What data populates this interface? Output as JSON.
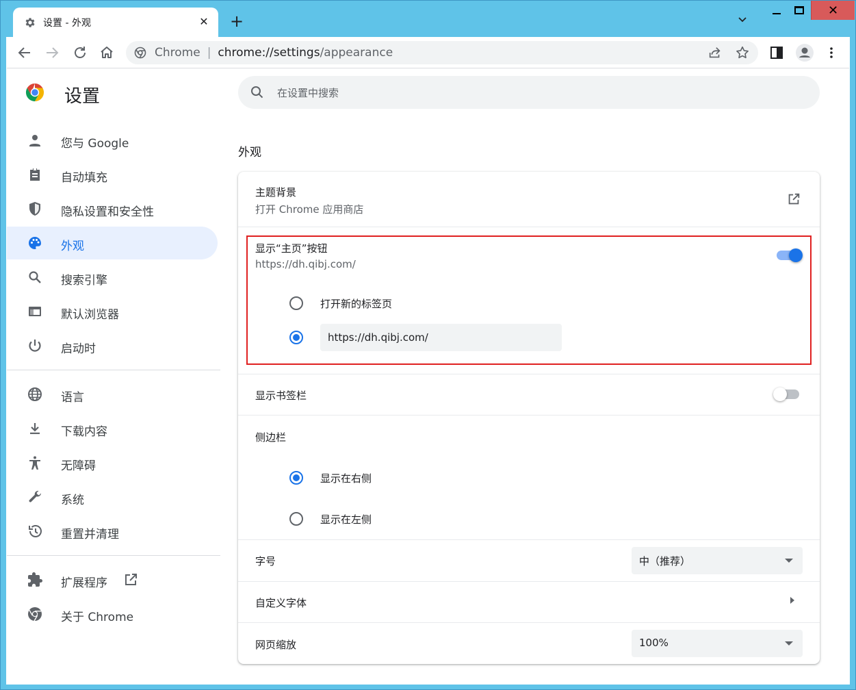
{
  "colors": {
    "accent": "#1a73e8",
    "highlight_border": "#e02020",
    "frame": "#5fc3e8"
  },
  "tab": {
    "title": "设置 - 外观",
    "icon": "gear-icon"
  },
  "omnibox": {
    "site_label": "Chrome",
    "url_host": "chrome://settings",
    "url_path": "/appearance"
  },
  "settings": {
    "title": "设置",
    "search_placeholder": "在设置中搜索"
  },
  "sidebar": {
    "items": [
      {
        "label": "您与 Google",
        "icon": "person-icon"
      },
      {
        "label": "自动填充",
        "icon": "clipboard-icon"
      },
      {
        "label": "隐私设置和安全性",
        "icon": "shield-icon"
      },
      {
        "label": "外观",
        "icon": "palette-icon",
        "active": true
      },
      {
        "label": "搜索引擎",
        "icon": "search-icon"
      },
      {
        "label": "默认浏览器",
        "icon": "browser-window-icon"
      },
      {
        "label": "启动时",
        "icon": "power-icon"
      },
      {
        "label": "语言",
        "icon": "globe-icon"
      },
      {
        "label": "下载内容",
        "icon": "download-icon"
      },
      {
        "label": "无障碍",
        "icon": "accessibility-icon"
      },
      {
        "label": "系统",
        "icon": "wrench-icon"
      },
      {
        "label": "重置并清理",
        "icon": "restore-icon"
      },
      {
        "label": "扩展程序",
        "icon": "puzzle-icon"
      },
      {
        "label": "关于 Chrome",
        "icon": "chrome-icon"
      }
    ]
  },
  "main": {
    "section_title": "外观",
    "theme": {
      "label": "主题背景",
      "sublabel": "打开 Chrome 应用商店"
    },
    "home_button": {
      "label": "显示“主页”按钮",
      "sublabel": "https://dh.qibj.com/",
      "enabled": true,
      "option_newtab": "打开新的标签页",
      "option_url_value": "https://dh.qibj.com/"
    },
    "bookmarks_bar": {
      "label": "显示书签栏",
      "enabled": false
    },
    "side_panel": {
      "label": "侧边栏",
      "option_right": "显示在右侧",
      "option_left": "显示在左侧",
      "selected": "right"
    },
    "font_size": {
      "label": "字号",
      "value": "中（推荐）"
    },
    "custom_fonts": {
      "label": "自定义字体"
    },
    "page_zoom": {
      "label": "网页缩放",
      "value": "100%"
    }
  }
}
